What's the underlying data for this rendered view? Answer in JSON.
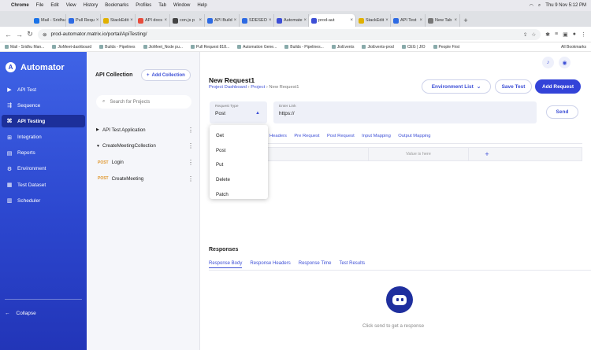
{
  "menubar": {
    "items": [
      "Chrome",
      "File",
      "Edit",
      "View",
      "History",
      "Bookmarks",
      "Profiles",
      "Tab",
      "Window",
      "Help"
    ],
    "clock": "Thu 9 Nov 5:12 PM"
  },
  "tabs": [
    {
      "label": "Mail - Sridhu",
      "color": "#1a73e8"
    },
    {
      "label": "Pull Requ",
      "color": "#2d6ae3"
    },
    {
      "label": "StackEdit",
      "color": "#e0b000"
    },
    {
      "label": "API docs",
      "color": "#e74c3c"
    },
    {
      "label": "con.js p",
      "color": "#444444"
    },
    {
      "label": "API Build",
      "color": "#2d6ae3"
    },
    {
      "label": "SDESEO",
      "color": "#2d6ae3"
    },
    {
      "label": "Automate",
      "color": "#3d4fd6"
    },
    {
      "label": "prod-aut",
      "color": "#3d4fd6",
      "active": true
    },
    {
      "label": "StackEdit",
      "color": "#e0b000"
    },
    {
      "label": "API Test",
      "color": "#2d6ae3"
    },
    {
      "label": "New Tab",
      "color": "#777777"
    }
  ],
  "address": {
    "url": "prod-automator.matrix.io/portal/ApiTesting/"
  },
  "bookmarks": {
    "items": [
      "Mail - Sridhu Man...",
      "JioMeet-dashboard",
      "Builds - Pipelines",
      "JioMeet_Node pu...",
      "Pull Request 818...",
      "Automation Gene...",
      "Builds - Pipelines...",
      "JioEvents",
      "JioEvents-prod",
      "CEG | JIO",
      "People First"
    ],
    "all": "All Bookmarks"
  },
  "sidebar": {
    "brand": "Automator",
    "items": [
      {
        "label": "API Test",
        "icon": "video-icon"
      },
      {
        "label": "Sequence",
        "icon": "sequence-icon"
      },
      {
        "label": "API Testing",
        "icon": "api-icon",
        "active": true
      },
      {
        "label": "Integration",
        "icon": "integration-icon"
      },
      {
        "label": "Reports",
        "icon": "document-icon"
      },
      {
        "label": "Environment",
        "icon": "gear-icon"
      },
      {
        "label": "Test Dataset",
        "icon": "dataset-icon"
      },
      {
        "label": "Scheduler",
        "icon": "calendar-icon"
      }
    ],
    "collapse": "Collapse"
  },
  "collection": {
    "title": "API Collection",
    "add_label": "Add Collection",
    "search_placeholder": "Search for Projects",
    "tree": [
      {
        "label": "API Test Application",
        "caret": "▶"
      },
      {
        "label": "CreateMeetingCollection",
        "caret": "▼"
      },
      {
        "label": "Login",
        "method": "POST"
      },
      {
        "label": "CreateMeeting",
        "method": "POST"
      }
    ]
  },
  "main": {
    "title": "New Request1",
    "breadcrumb": {
      "root": "Project Dashboard",
      "project": "Project",
      "current": "New Request1"
    },
    "env_label": "Environment List",
    "save_label": "Save Test",
    "add_request_label": "Add Request",
    "request_type": {
      "label": "Request Type",
      "value": "Post"
    },
    "link": {
      "label": "Enter Link",
      "value": "https://"
    },
    "send_label": "Send",
    "tabs": [
      "Headers",
      "Pre Request",
      "Post Request",
      "Input Mapping",
      "Output Mapping"
    ],
    "value_placeholder": "Value is here",
    "methods": [
      "Get",
      "Post",
      "Put",
      "Delete",
      "Patch"
    ]
  },
  "response": {
    "title": "Responses",
    "tabs": [
      "Response Body",
      "Response Headers",
      "Response Time",
      "Test Results"
    ],
    "hint": "Click send to get a response"
  }
}
